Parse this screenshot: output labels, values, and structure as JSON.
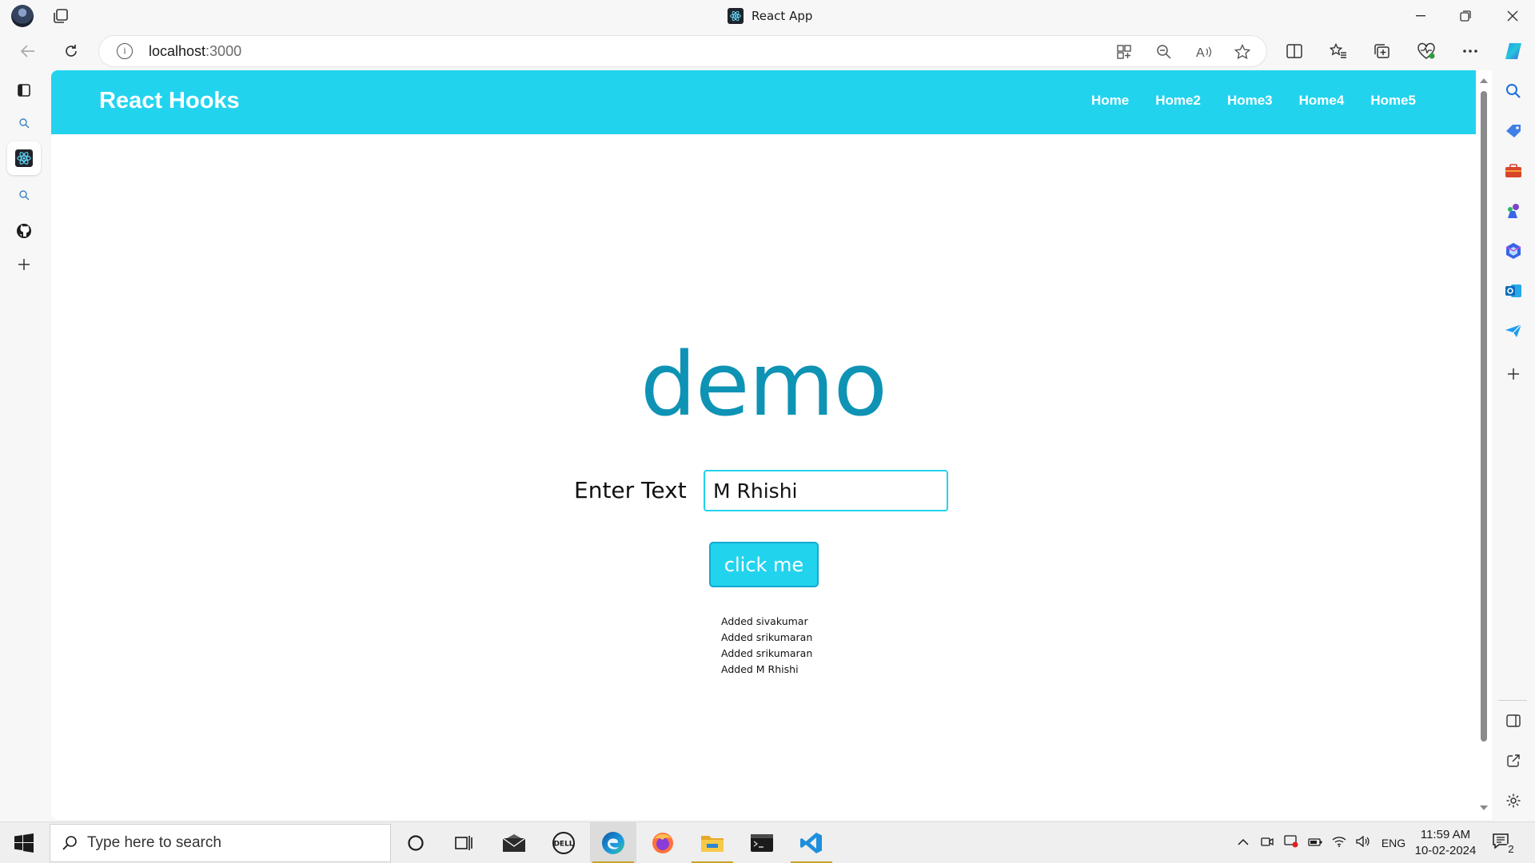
{
  "browser": {
    "tab_title": "React App",
    "url_host": "localhost",
    "url_port": ":3000"
  },
  "app": {
    "brand": "React Hooks",
    "nav_links": [
      "Home",
      "Home2",
      "Home3",
      "Home4",
      "Home5"
    ],
    "heading": "demo",
    "input_label": "Enter Text",
    "input_value": "M Rhishi",
    "button_label": "click me",
    "log_entries": [
      "Added sivakumar",
      "Added srikumaran",
      "Added srikumaran",
      "Added M Rhishi"
    ]
  },
  "taskbar": {
    "search_placeholder": "Type here to search",
    "language": "ENG",
    "time": "11:59 AM",
    "date": "10-02-2024",
    "notification_count": "2"
  },
  "colors": {
    "navbar": "#22d3ee",
    "heading": "#0e93b5",
    "button": "#22d3ee"
  }
}
